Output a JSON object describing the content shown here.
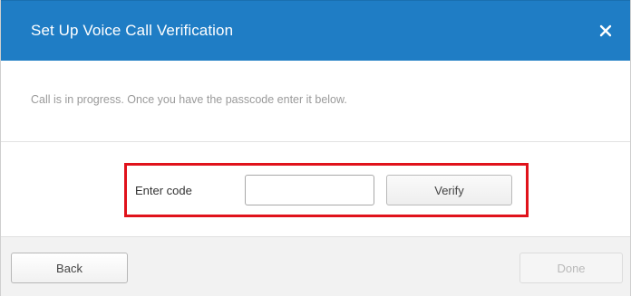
{
  "dialog": {
    "title": "Set Up Voice Call Verification",
    "close_icon": "close-icon"
  },
  "message": {
    "text": "Call is in progress. Once you have the passcode enter it below."
  },
  "code_entry": {
    "label": "Enter code",
    "input_value": "",
    "verify_label": "Verify",
    "highlight_color": "#e0121b"
  },
  "footer": {
    "back_label": "Back",
    "done_label": "Done",
    "done_disabled": true
  },
  "colors": {
    "header_bg": "#1f7dc5",
    "footer_bg": "#f2f2f2",
    "message_text": "#9a9a9a"
  }
}
